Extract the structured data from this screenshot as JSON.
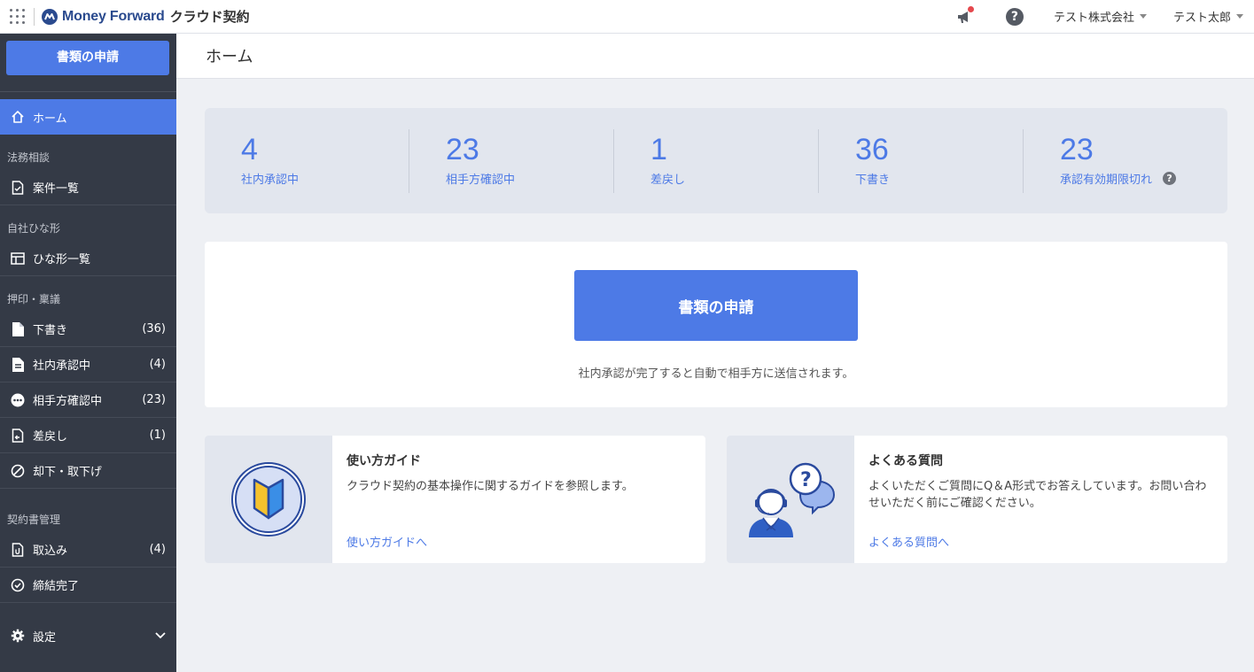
{
  "topbar": {
    "brand_name": "Money Forward",
    "brand_product": "クラウド契約",
    "company": "テスト株式会社",
    "user": "テスト太郎",
    "icons": {
      "apps": "grid-icon",
      "announce": "megaphone-icon",
      "help": "help-icon"
    }
  },
  "sidebar": {
    "apply_button": "書類の申請",
    "home": "ホーム",
    "sections": {
      "legal": "法務相談",
      "templates": "自社ひな形",
      "seal": "押印・稟議",
      "contracts": "契約書管理"
    },
    "items": {
      "cases": "案件一覧",
      "template_list": "ひな形一覧",
      "drafts": {
        "label": "下書き",
        "count": "(36)"
      },
      "internal": {
        "label": "社内承認中",
        "count": "(4)"
      },
      "partner": {
        "label": "相手方確認中",
        "count": "(23)"
      },
      "returned": {
        "label": "差戻し",
        "count": "(1)"
      },
      "rejected": "却下・取下げ",
      "imported": {
        "label": "取込み",
        "count": "(4)"
      },
      "concluded": "締結完了",
      "settings": "設定"
    }
  },
  "page": {
    "title": "ホーム"
  },
  "stats": [
    {
      "value": "4",
      "label": "社内承認中"
    },
    {
      "value": "23",
      "label": "相手方確認中"
    },
    {
      "value": "1",
      "label": "差戻し"
    },
    {
      "value": "36",
      "label": "下書き"
    },
    {
      "value": "23",
      "label": "承認有効期限切れ"
    }
  ],
  "apply": {
    "button": "書類の申請",
    "note": "社内承認が完了すると自動で相手方に送信されます。"
  },
  "guide": {
    "title": "使い方ガイド",
    "desc": "クラウド契約の基本操作に関するガイドを参照します。",
    "link": "使い方ガイドへ"
  },
  "faq": {
    "title": "よくある質問",
    "desc": "よくいただくご質問にQ＆A形式でお答えしています。お問い合わせいただく前にご確認ください。",
    "link": "よくある質問へ"
  },
  "colors": {
    "accent": "#4d7ae6",
    "sidebar": "#343a46"
  }
}
